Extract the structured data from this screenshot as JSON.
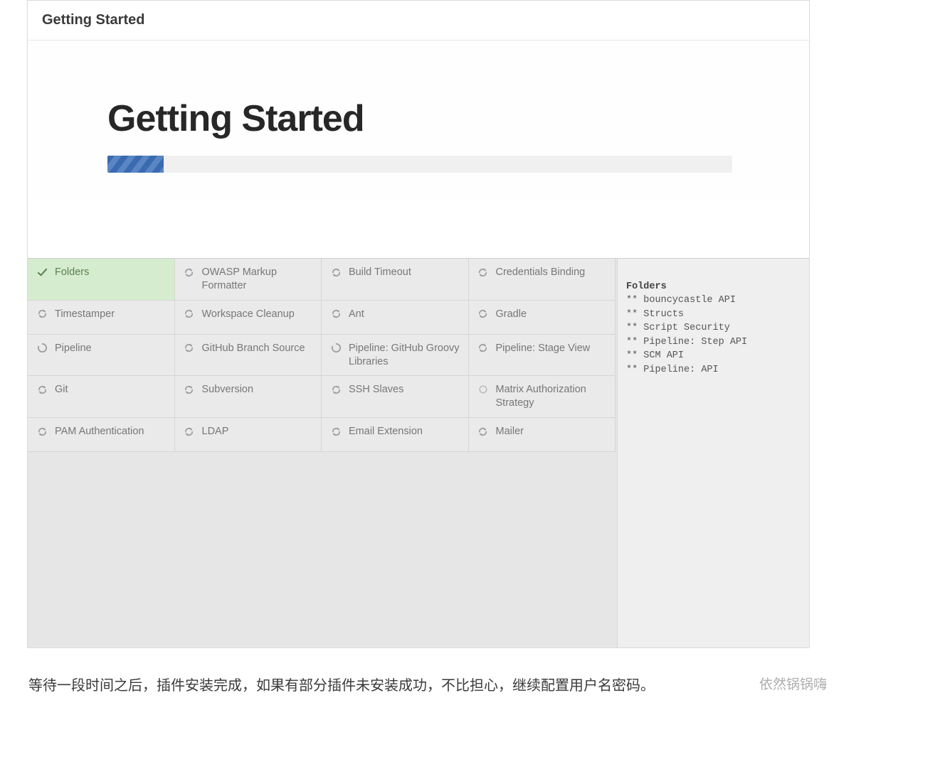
{
  "header": {
    "small_title": "Getting Started"
  },
  "hero": {
    "title": "Getting Started",
    "progress_percent": 9
  },
  "plugins": [
    [
      {
        "name": "Folders",
        "status": "done"
      },
      {
        "name": "OWASP Markup Formatter",
        "status": "pending"
      },
      {
        "name": "Build Timeout",
        "status": "pending"
      },
      {
        "name": "Credentials Binding",
        "status": "pending"
      }
    ],
    [
      {
        "name": "Timestamper",
        "status": "pending"
      },
      {
        "name": "Workspace Cleanup",
        "status": "pending"
      },
      {
        "name": "Ant",
        "status": "pending"
      },
      {
        "name": "Gradle",
        "status": "pending"
      }
    ],
    [
      {
        "name": "Pipeline",
        "status": "loading"
      },
      {
        "name": "GitHub Branch Source",
        "status": "pending"
      },
      {
        "name": "Pipeline: GitHub Groovy Libraries",
        "status": "loading"
      },
      {
        "name": "Pipeline: Stage View",
        "status": "pending"
      }
    ],
    [
      {
        "name": "Git",
        "status": "pending"
      },
      {
        "name": "Subversion",
        "status": "pending"
      },
      {
        "name": "SSH Slaves",
        "status": "pending"
      },
      {
        "name": "Matrix Authorization Strategy",
        "status": "idle"
      }
    ],
    [
      {
        "name": "PAM Authentication",
        "status": "pending"
      },
      {
        "name": "LDAP",
        "status": "pending"
      },
      {
        "name": "Email Extension",
        "status": "pending"
      },
      {
        "name": "Mailer",
        "status": "pending"
      }
    ]
  ],
  "log": {
    "title": "Folders",
    "lines": [
      "** bouncycastle API",
      "** Structs",
      "** Script Security",
      "** Pipeline: Step API",
      "** SCM API",
      "** Pipeline: API"
    ]
  },
  "caption": "等待一段时间之后，插件安装完成，如果有部分插件未安装成功，不比担心，继续配置用户名密码。",
  "watermark": "依然锅锅嗨"
}
